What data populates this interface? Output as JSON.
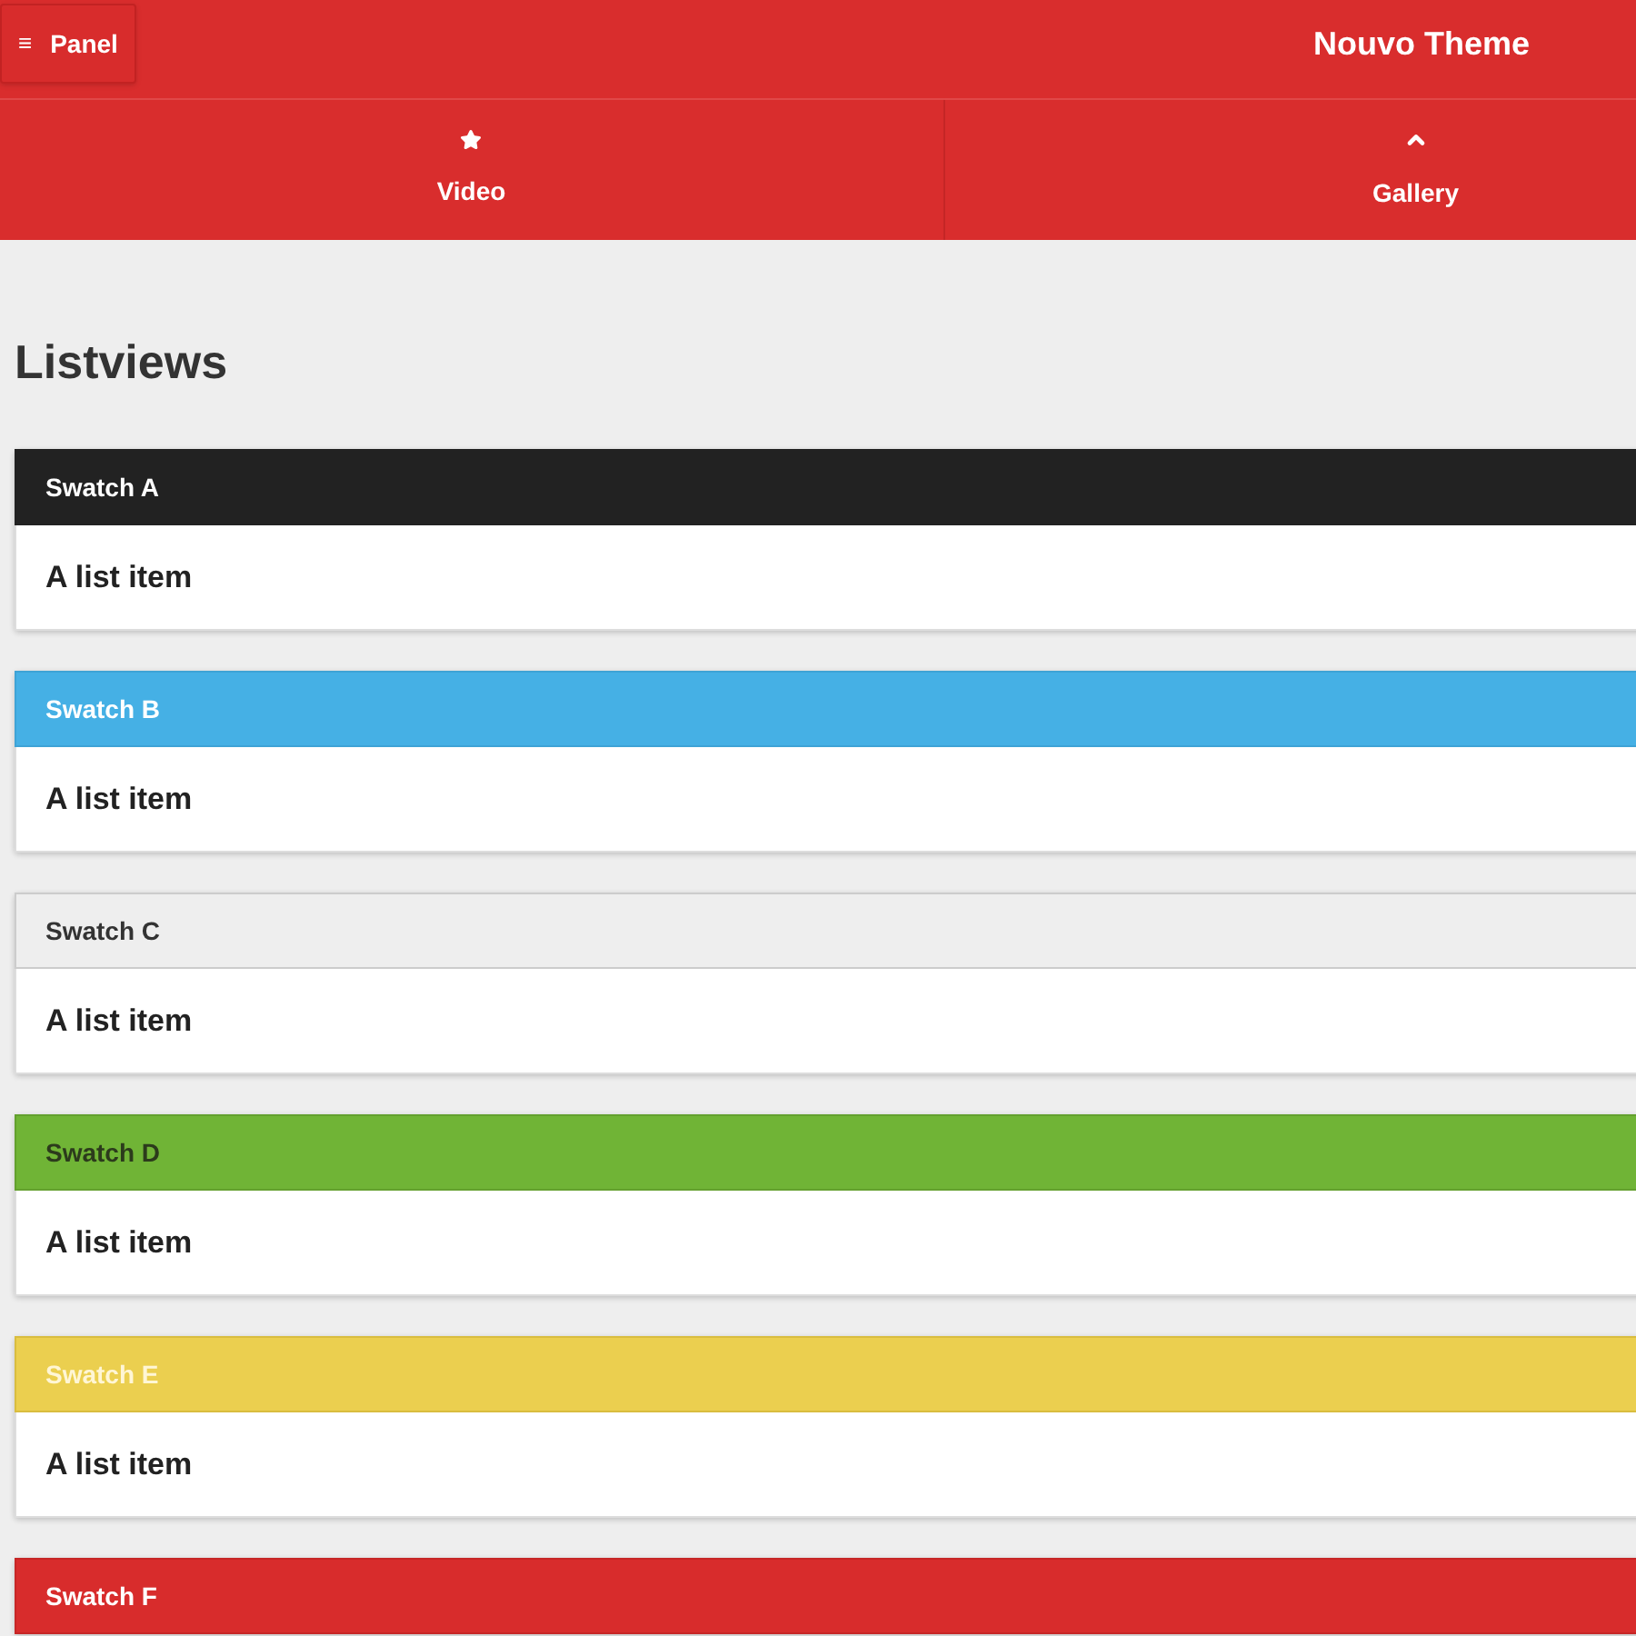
{
  "header": {
    "panel_button": {
      "icon": "≡",
      "label": "Panel"
    },
    "title": "Nouvo Theme"
  },
  "navbar": [
    {
      "label": "Video"
    },
    {
      "label": "Gallery"
    }
  ],
  "heading": "Listviews",
  "listviews": [
    {
      "divider": "Swatch A",
      "color": "#222222",
      "items": [
        "A list item"
      ]
    },
    {
      "divider": "Swatch B",
      "color": "#45b0e5",
      "items": [
        "A list item"
      ]
    },
    {
      "divider": "Swatch C",
      "color": "#eeeeee",
      "items": [
        "A list item"
      ]
    },
    {
      "divider": "Swatch D",
      "color": "#70b436",
      "items": [
        "A list item"
      ]
    },
    {
      "divider": "Swatch E",
      "color": "#ebcf4f",
      "items": [
        "A list item"
      ]
    },
    {
      "divider": "Swatch F",
      "color": "#d82c2c"
    }
  ]
}
